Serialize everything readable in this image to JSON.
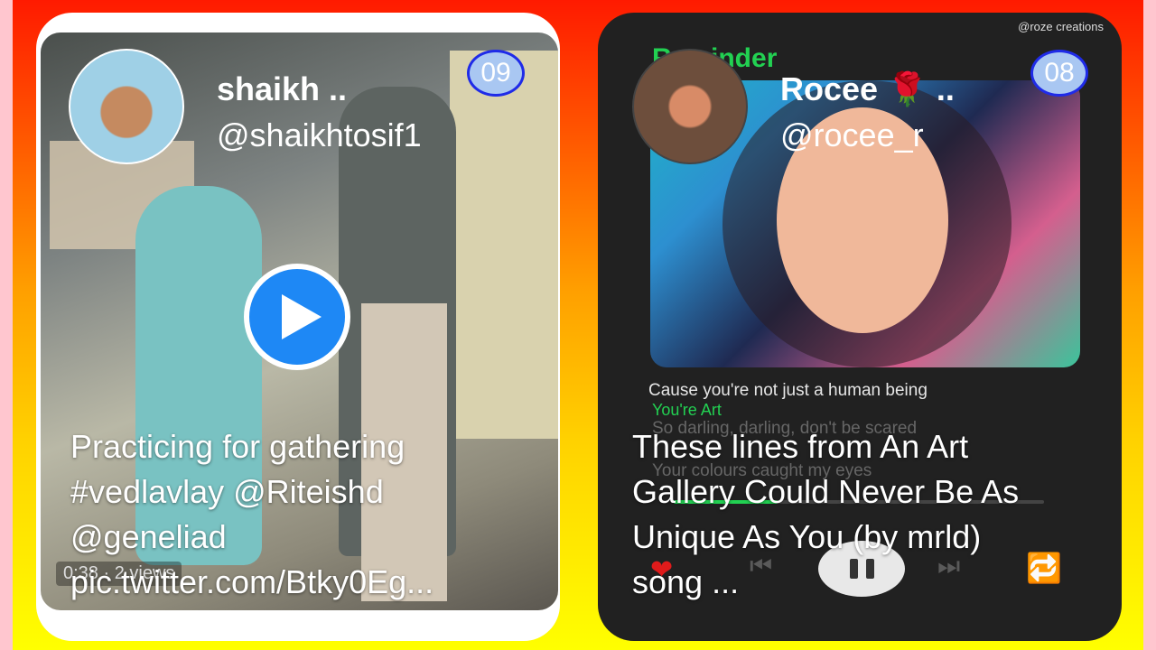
{
  "cards": [
    {
      "badge": "09",
      "name": "shaikh ..",
      "handle": "@shaikhtosif1",
      "caption_lines": [
        "Practicing for gathering",
        "#vedlavlay @Riteishd",
        "@geneliad",
        "pic.twitter.com/Btky0Eg..."
      ],
      "meta": "0:38 · 2",
      "meta_views": "views"
    },
    {
      "badge": "08",
      "name": "Rocee 🌹 ..",
      "handle": "@rocee_r",
      "caption_lines": [
        "These lines from An Art",
        "Gallery Could Never Be As",
        "Unique As You (by mrld)",
        "song ..."
      ],
      "watermark": "@roze creations",
      "reminder": "Reminder",
      "lyrics": {
        "line1": "Cause you're not just a human being",
        "line2": "You're Art",
        "line3": "So darling, darling, don't be scared",
        "line4": "Your colours caught my eyes"
      },
      "progress": 0.28
    }
  ],
  "colors": {
    "badge_border": "#1f2be8",
    "play": "#1e88f5",
    "spotify_green": "#22d152",
    "heart": "#e01b1b"
  },
  "icons": [
    "play-icon",
    "pause-icon",
    "heart-icon",
    "prev-icon",
    "next-icon",
    "repeat-icon"
  ]
}
